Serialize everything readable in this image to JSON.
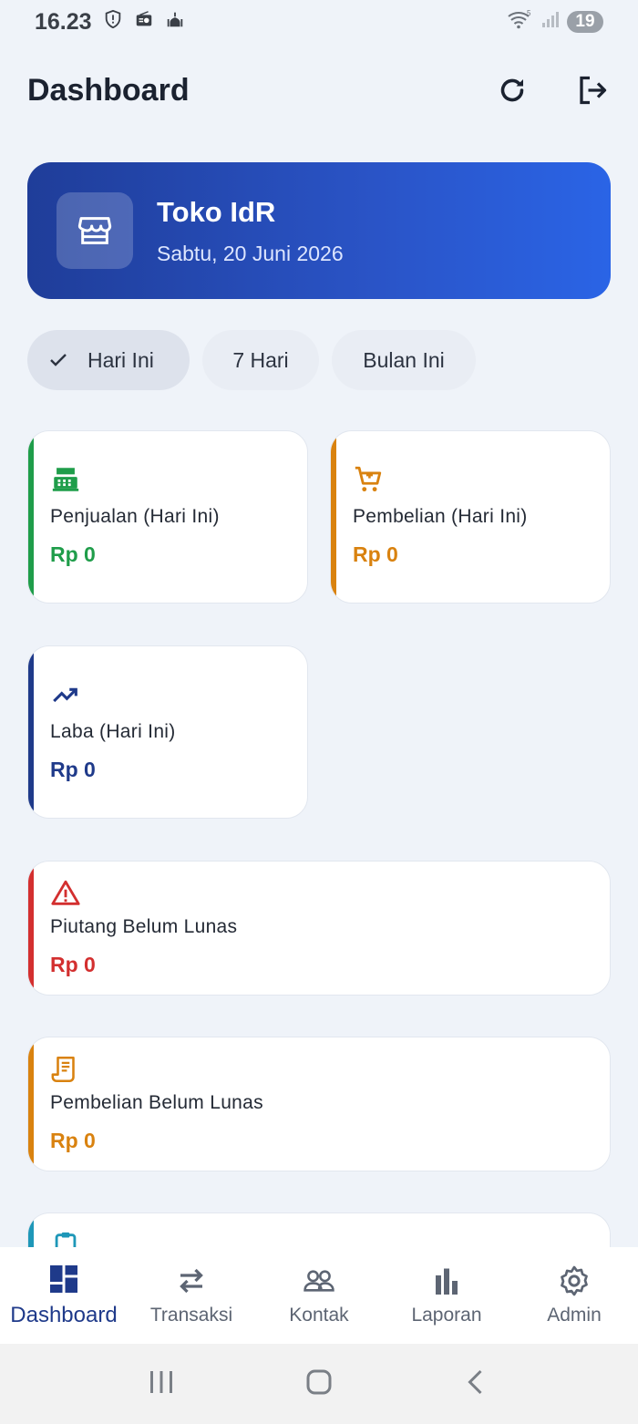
{
  "status_bar": {
    "time": "16.23",
    "signal_label": "5",
    "battery": "19"
  },
  "appbar": {
    "title": "Dashboard"
  },
  "store": {
    "name": "Toko IdR",
    "date": "Sabtu, 20 Juni 2026"
  },
  "filters": [
    {
      "label": "Hari Ini",
      "selected": true
    },
    {
      "label": "7 Hari",
      "selected": false
    },
    {
      "label": "Bulan Ini",
      "selected": false
    }
  ],
  "cards": {
    "sales": {
      "label": "Penjualan (Hari Ini)",
      "value": "Rp 0",
      "color": "#1f9d4a"
    },
    "purchases": {
      "label": "Pembelian (Hari Ini)",
      "value": "Rp 0",
      "color": "#d9820f"
    },
    "profit": {
      "label": "Laba (Hari Ini)",
      "value": "Rp 0",
      "color": "#1f3a8a"
    },
    "receivables": {
      "label": "Piutang Belum Lunas",
      "value": "Rp 0",
      "color": "#d32f2f"
    },
    "payables": {
      "label": "Pembelian Belum Lunas",
      "value": "Rp 0",
      "color": "#d9820f"
    },
    "partial_color": "#1e97b8"
  },
  "bottom_nav": [
    {
      "label": "Dashboard",
      "icon": "dashboard-icon",
      "active": true
    },
    {
      "label": "Transaksi",
      "icon": "swap-icon",
      "active": false
    },
    {
      "label": "Kontak",
      "icon": "people-icon",
      "active": false
    },
    {
      "label": "Laporan",
      "icon": "bar-chart-icon",
      "active": false
    },
    {
      "label": "Admin",
      "icon": "gear-icon",
      "active": false
    }
  ]
}
